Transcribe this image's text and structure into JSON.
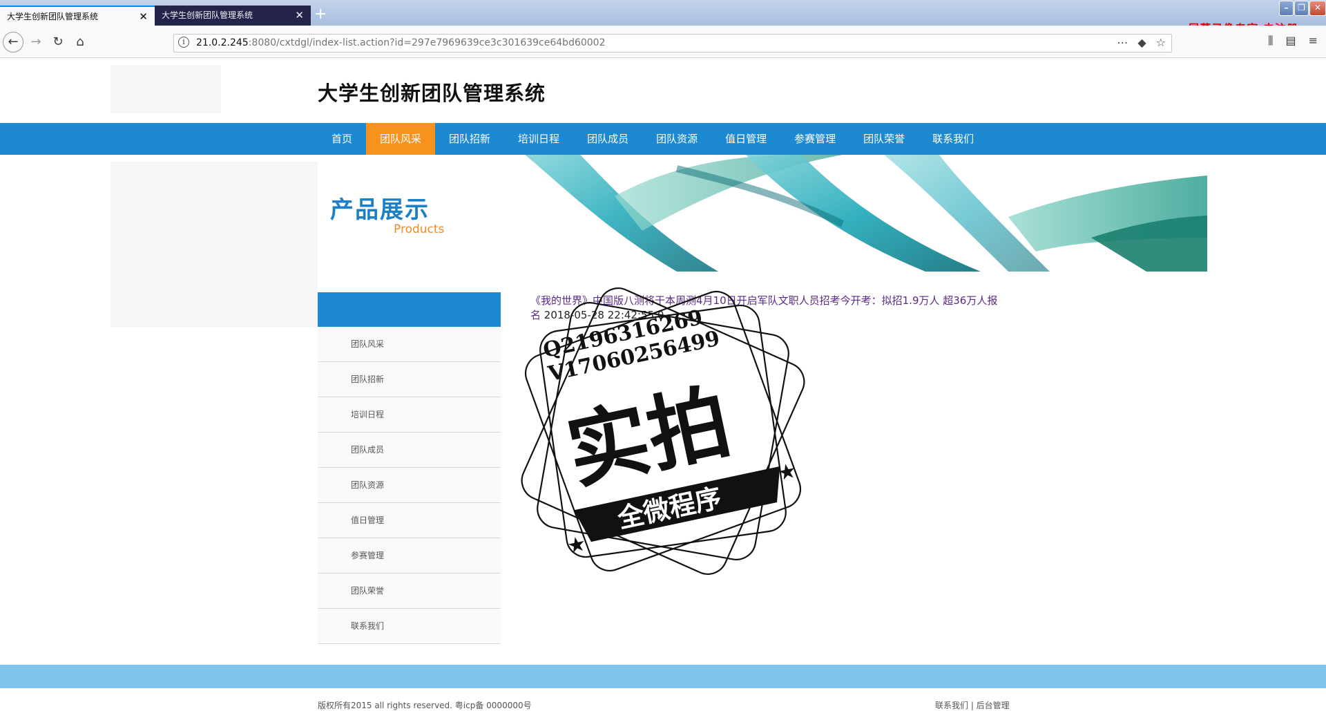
{
  "browser": {
    "tabs": [
      {
        "title": "大学生创新团队管理系统",
        "active": true
      },
      {
        "title": "大学生创新团队管理系统",
        "active": false
      }
    ],
    "new_tab": "+",
    "url_host": "21.0.2.245",
    "url_path": ":8080/cxtdgl/index-list.action?id=297e7969639ce3c301639ce64bd60002",
    "recorder_watermark": "屏幕录像专家  未注册"
  },
  "site": {
    "title": "大学生创新团队管理系统",
    "nav": [
      "首页",
      "团队风采",
      "团队招新",
      "培训日程",
      "团队成员",
      "团队资源",
      "值日管理",
      "参赛管理",
      "团队荣誉",
      "联系我们"
    ],
    "nav_active": "团队风采",
    "banner": {
      "title": "产品展示",
      "subtitle": "Products"
    },
    "sidebar": [
      "团队风采",
      "团队招新",
      "培训日程",
      "团队成员",
      "团队资源",
      "值日管理",
      "参赛管理",
      "团队荣誉",
      "联系我们"
    ],
    "article": {
      "title": "《我的世界》中国版八测将于本周测4月10日开启军队文职人员招考今开考：拟招1.9万人 超36万人报名",
      "date": "2018-05-28 22:42:55.0"
    },
    "footer": {
      "copyright": "版权所有2015 all rights reserved. 粤icp备 0000000号",
      "links": "联系我们 | 后台管理"
    }
  },
  "stamp": {
    "qq": "Q2196316269",
    "wechat": "V17060256499",
    "main": "实拍",
    "ribbon": "全微程序"
  },
  "colors": {
    "nav_blue": "#1d89d1",
    "nav_active_orange": "#f7931d",
    "footer_band": "#7ec5ec",
    "link_purple": "#5b2a86"
  }
}
